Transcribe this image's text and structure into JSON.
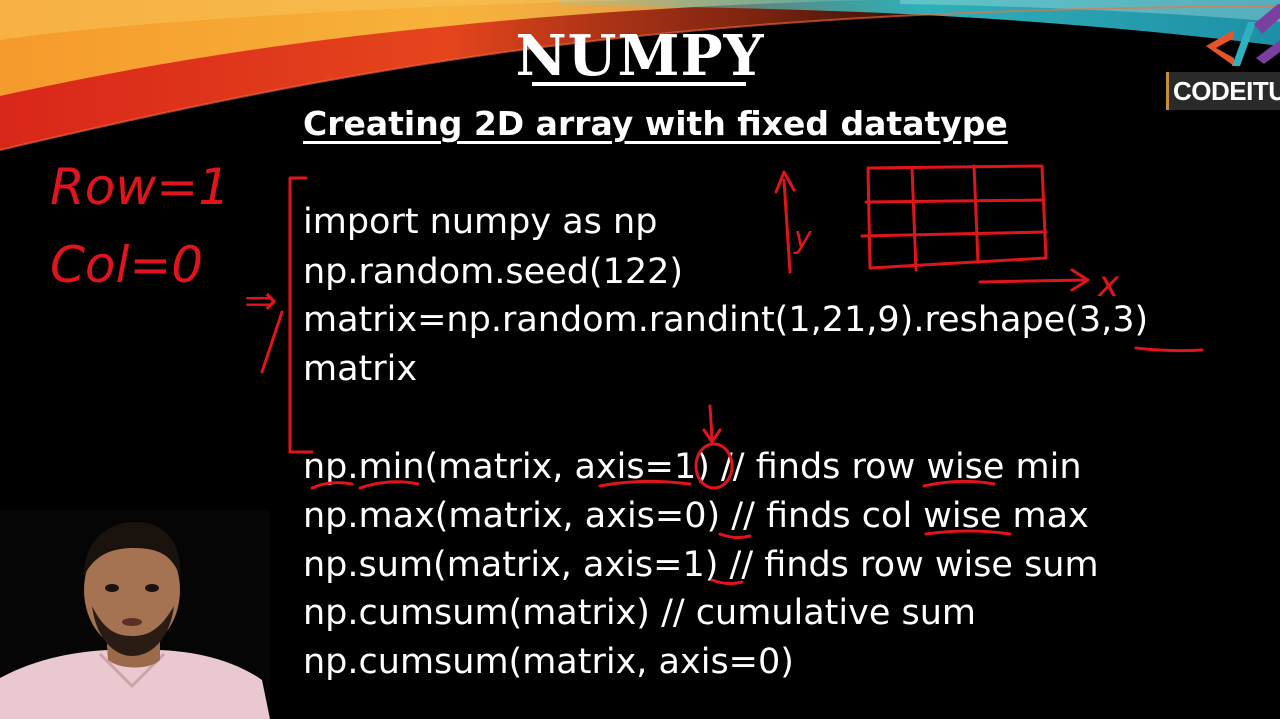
{
  "slide": {
    "title": "NUMPY",
    "subtitle": "Creating 2D array with fixed datatype",
    "brand": "CODEITUP"
  },
  "code": {
    "lines": [
      "import numpy as np",
      "np.random.seed(122)",
      "matrix=np.random.randint(1,21,9).reshape(3,3)",
      "matrix",
      "np.min(matrix, axis=1) // finds row wise min",
      "np.max(matrix, axis=0) // finds col wise max",
      "np.sum(matrix, axis=1) // finds row wise sum",
      "np.cumsum(matrix) // cumulative sum",
      "np.cumsum(matrix, axis=0)"
    ]
  },
  "annotations": {
    "row_note": "Row=1",
    "col_note": "Col=0",
    "y_axis_label": "y",
    "x_axis_label": "x",
    "arrow_mark": "⇒",
    "ink_color": "#e0141c"
  },
  "colors": {
    "background": "#000000",
    "text": "#ffffff",
    "banner_red": "#e0301e",
    "banner_orange": "#f39a2b",
    "banner_teal": "#2bb3b9",
    "logo_plate": "#2a2a2a"
  }
}
